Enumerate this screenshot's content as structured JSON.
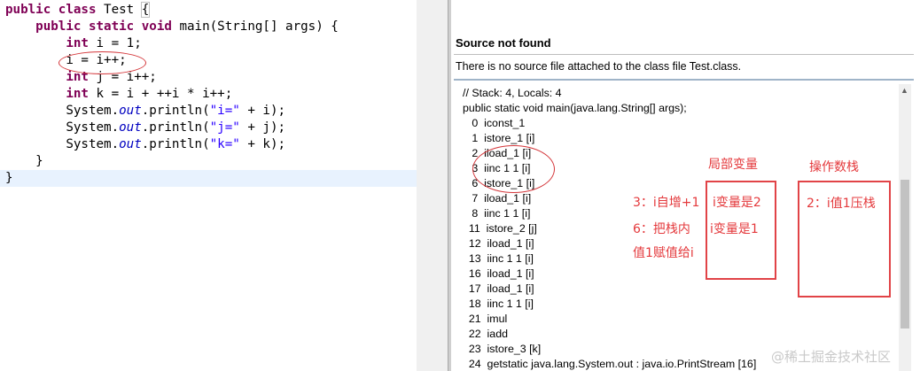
{
  "editor": {
    "lines": [
      [
        {
          "t": "public",
          "c": "kw"
        },
        {
          "t": " "
        },
        {
          "t": "class",
          "c": "kw"
        },
        {
          "t": " Test "
        },
        {
          "t": "{",
          "c": "brace"
        }
      ],
      [
        {
          "t": "    "
        },
        {
          "t": "public",
          "c": "kw"
        },
        {
          "t": " "
        },
        {
          "t": "static",
          "c": "kw"
        },
        {
          "t": " "
        },
        {
          "t": "void",
          "c": "kw"
        },
        {
          "t": " main(String[] args) {"
        }
      ],
      [
        {
          "t": "        "
        },
        {
          "t": "int",
          "c": "kw"
        },
        {
          "t": " i = 1;"
        }
      ],
      [
        {
          "t": "        i = i++;"
        }
      ],
      [
        {
          "t": "        "
        },
        {
          "t": "int",
          "c": "kw"
        },
        {
          "t": " j = i++;"
        }
      ],
      [
        {
          "t": "        "
        },
        {
          "t": "int",
          "c": "kw"
        },
        {
          "t": " k = i + ++i * i++;"
        }
      ],
      [
        {
          "t": "        System."
        },
        {
          "t": "out",
          "c": "fld"
        },
        {
          "t": ".println("
        },
        {
          "t": "\"i=\"",
          "c": "str"
        },
        {
          "t": " + i);"
        }
      ],
      [
        {
          "t": "        System."
        },
        {
          "t": "out",
          "c": "fld"
        },
        {
          "t": ".println("
        },
        {
          "t": "\"j=\"",
          "c": "str"
        },
        {
          "t": " + j);"
        }
      ],
      [
        {
          "t": "        System."
        },
        {
          "t": "out",
          "c": "fld"
        },
        {
          "t": ".println("
        },
        {
          "t": "\"k=\"",
          "c": "str"
        },
        {
          "t": " + k);"
        }
      ],
      [
        {
          "t": "    }"
        }
      ],
      [
        {
          "t": "}"
        }
      ]
    ]
  },
  "viewer": {
    "title": "Source not found",
    "message": "There is no source file attached to the class file Test.class.",
    "bytecode": [
      "// Stack: 4, Locals: 4",
      "public static void main(java.lang.String[] args);",
      "   0  iconst_1",
      "   1  istore_1 [i]",
      "   2  iload_1 [i]",
      "   3  iinc 1 1 [i]",
      "   6  istore_1 [i]",
      "   7  iload_1 [i]",
      "   8  iinc 1 1 [i]",
      "  11  istore_2 [j]",
      "  12  iload_1 [i]",
      "  13  iinc 1 1 [i]",
      "  16  iload_1 [i]",
      "  17  iload_1 [i]",
      "  18  iinc 1 1 [i]",
      "  21  imul",
      "  22  iadd",
      "  23  istore_3 [k]",
      "  24  getstatic java.lang.System.out : java.io.PrintStream [16]"
    ]
  },
  "annotations": {
    "local_vars_title": "局部变量",
    "stack_title": "操作数栈",
    "step3": "3：i自增+1",
    "local_value_2": "i变量是2",
    "step6_line1": "6：把栈内",
    "step6_line2": "值1赋值给i",
    "local_value_1": "i变量是1",
    "stack_step2": "2：i值1压栈"
  },
  "watermark": "@稀土掘金技术社区",
  "colors": {
    "keyword": "#7f0055",
    "string": "#2a00ff",
    "field": "#0000c0",
    "annotation": "#e4393c"
  }
}
